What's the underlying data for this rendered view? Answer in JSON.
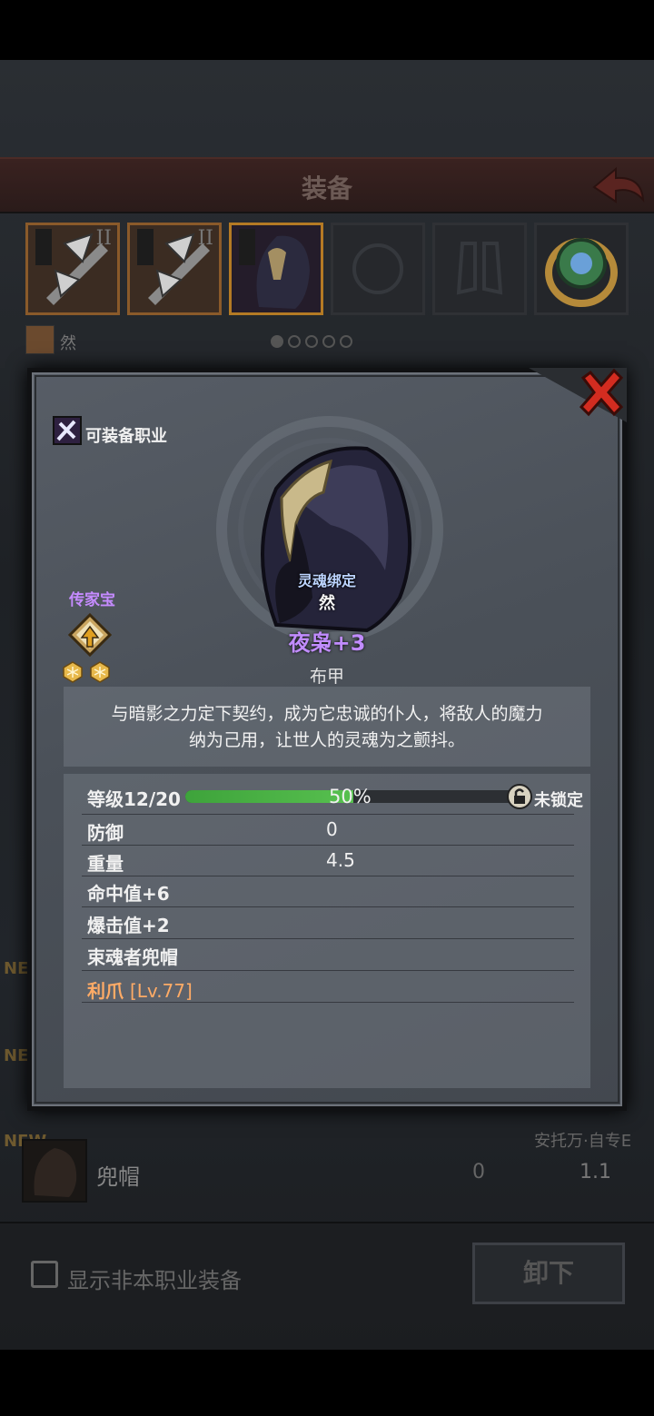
{
  "header": {
    "title": "装备"
  },
  "slots": [
    {
      "roman": "II"
    },
    {
      "roman": "II"
    },
    {
      "roman": ""
    },
    {
      "roman": ""
    },
    {
      "roman": ""
    },
    {
      "roman": ""
    }
  ],
  "character": {
    "name": "然"
  },
  "page_dots": {
    "count": 5,
    "active": 0
  },
  "list": {
    "new_tags": [
      "NE",
      "NE",
      "NEW"
    ],
    "row_req": "安托万·自专E",
    "row_name": "兜帽",
    "row_value1": "0",
    "row_value2": "1.1"
  },
  "bottom": {
    "checkbox_label": "显示非本职业装备",
    "unequip_label": "卸下"
  },
  "dialog": {
    "class_label": "可装备职业",
    "bind_label": "灵魂绑定",
    "owner": "然",
    "item_name": "夜枭+3",
    "item_type": "布甲",
    "heirloom_label": "传家宝",
    "heirloom_stars": 2,
    "description_line1": "与暗影之力定下契约，成为它忠诚的仆人，将敌人的魔力",
    "description_line2": "纳为己用，让世人的灵魂为之颤抖。",
    "level": {
      "label": "等级12/20",
      "percent_text": "50%",
      "progress": 0.5,
      "lock_label": "未锁定"
    },
    "stats": [
      {
        "label": "防御",
        "value": "0"
      },
      {
        "label": "重量",
        "value": "4.5"
      },
      {
        "label": "命中值+6",
        "value": ""
      },
      {
        "label": "爆击值+2",
        "value": ""
      },
      {
        "label": "束魂者兜帽",
        "value": ""
      }
    ],
    "skill": {
      "name": "利爪",
      "level": "[Lv.77]"
    }
  },
  "colors": {
    "item_name": "#c18cff",
    "skill": "#ffab66",
    "xp_fill": "#57c04f",
    "close": "#d32c20"
  }
}
